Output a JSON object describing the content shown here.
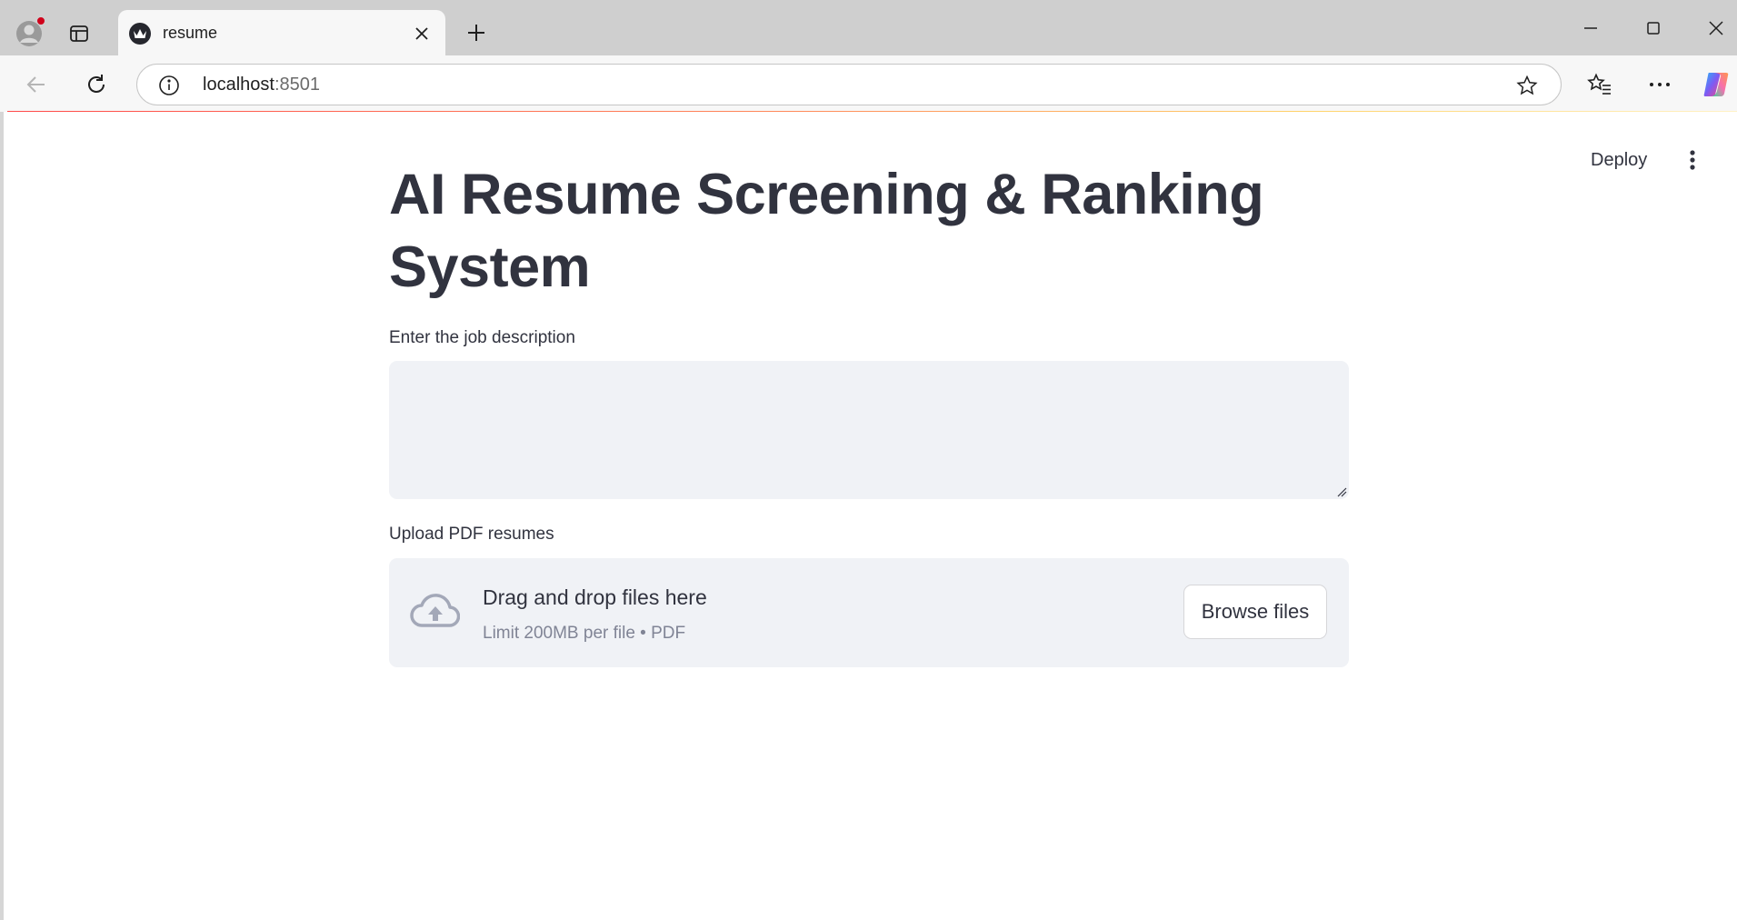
{
  "browser": {
    "tab_title": "resume",
    "url_host": "localhost",
    "url_port": ":8501"
  },
  "app": {
    "deploy_label": "Deploy",
    "title": "AI Resume Screening & Ranking System",
    "job_description": {
      "label": "Enter the job description",
      "value": ""
    },
    "uploader": {
      "label": "Upload PDF resumes",
      "drop_text": "Drag and drop files here",
      "limit_text": "Limit 200MB per file • PDF",
      "browse_label": "Browse files"
    }
  },
  "colors": {
    "primary": "#ff4b4b",
    "text": "#31333f",
    "input_bg": "#f0f2f6",
    "muted_text": "#808495"
  }
}
